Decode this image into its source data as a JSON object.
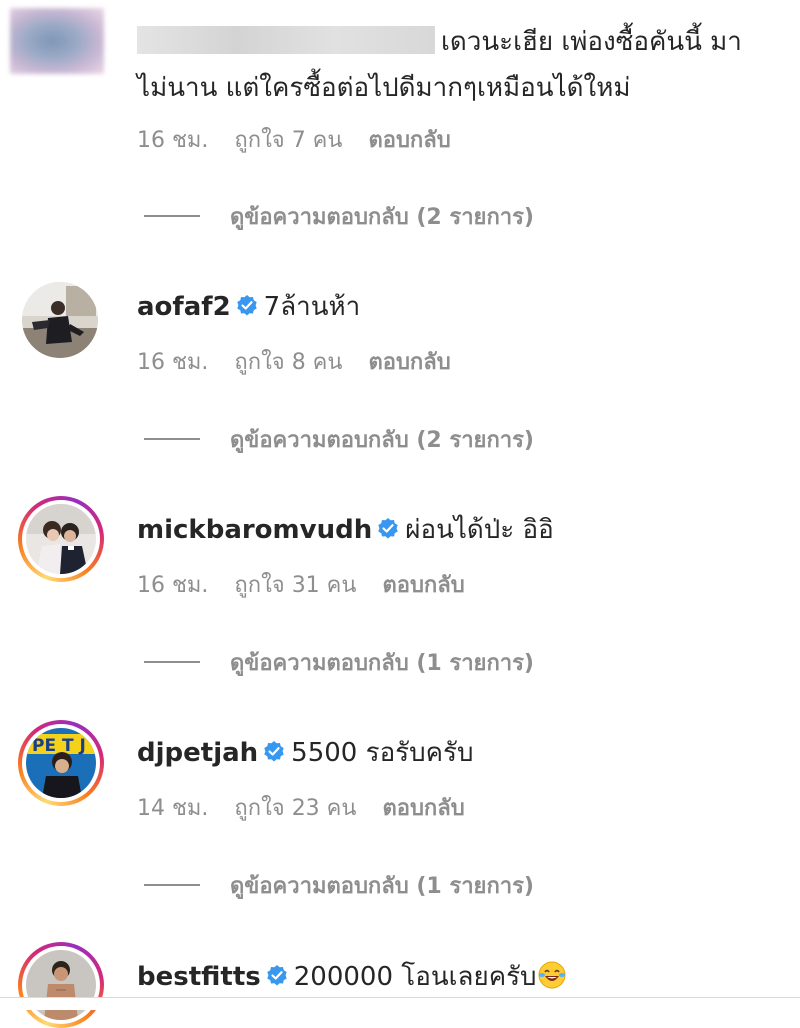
{
  "comments": [
    {
      "username": "",
      "verified": false,
      "text_line1": "เดวนะเฮีย เพ่องซื้อคันนี้ มา",
      "text_line2": "ไม่นาน แต่ใครซื้อต่อไปดีมากๆเหมือนได้ใหม่",
      "time": "16 ชม.",
      "likes": "ถูกใจ 7 คน",
      "reply": "ตอบกลับ",
      "view_replies": "ดูข้อความตอบกลับ (2 รายการ)"
    },
    {
      "username": "aofaf2",
      "verified": true,
      "text_line1": "7ล้านห้า",
      "time": "16 ชม.",
      "likes": "ถูกใจ 8 คน",
      "reply": "ตอบกลับ",
      "view_replies": "ดูข้อความตอบกลับ (2 รายการ)"
    },
    {
      "username": "mickbaromvudh",
      "verified": true,
      "text_line1": "ผ่อนได้ป่ะ อิอิ",
      "time": "16 ชม.",
      "likes": "ถูกใจ 31 คน",
      "reply": "ตอบกลับ",
      "view_replies": "ดูข้อความตอบกลับ (1 รายการ)"
    },
    {
      "username": "djpetjah",
      "verified": true,
      "text_line1": "5500 รอรับครับ",
      "time": "14 ชม.",
      "likes": "ถูกใจ 23 คน",
      "reply": "ตอบกลับ",
      "view_replies": "ดูข้อความตอบกลับ (1 รายการ)"
    },
    {
      "username": "bestfitts",
      "verified": true,
      "text_line1": "200000 โอนเลยครับ",
      "emoji": "rolling-on-floor-laughing-emoji"
    }
  ],
  "colors": {
    "verified_badge": "#3897f0",
    "meta_text": "#8e8e8e",
    "primary_text": "#262626"
  }
}
